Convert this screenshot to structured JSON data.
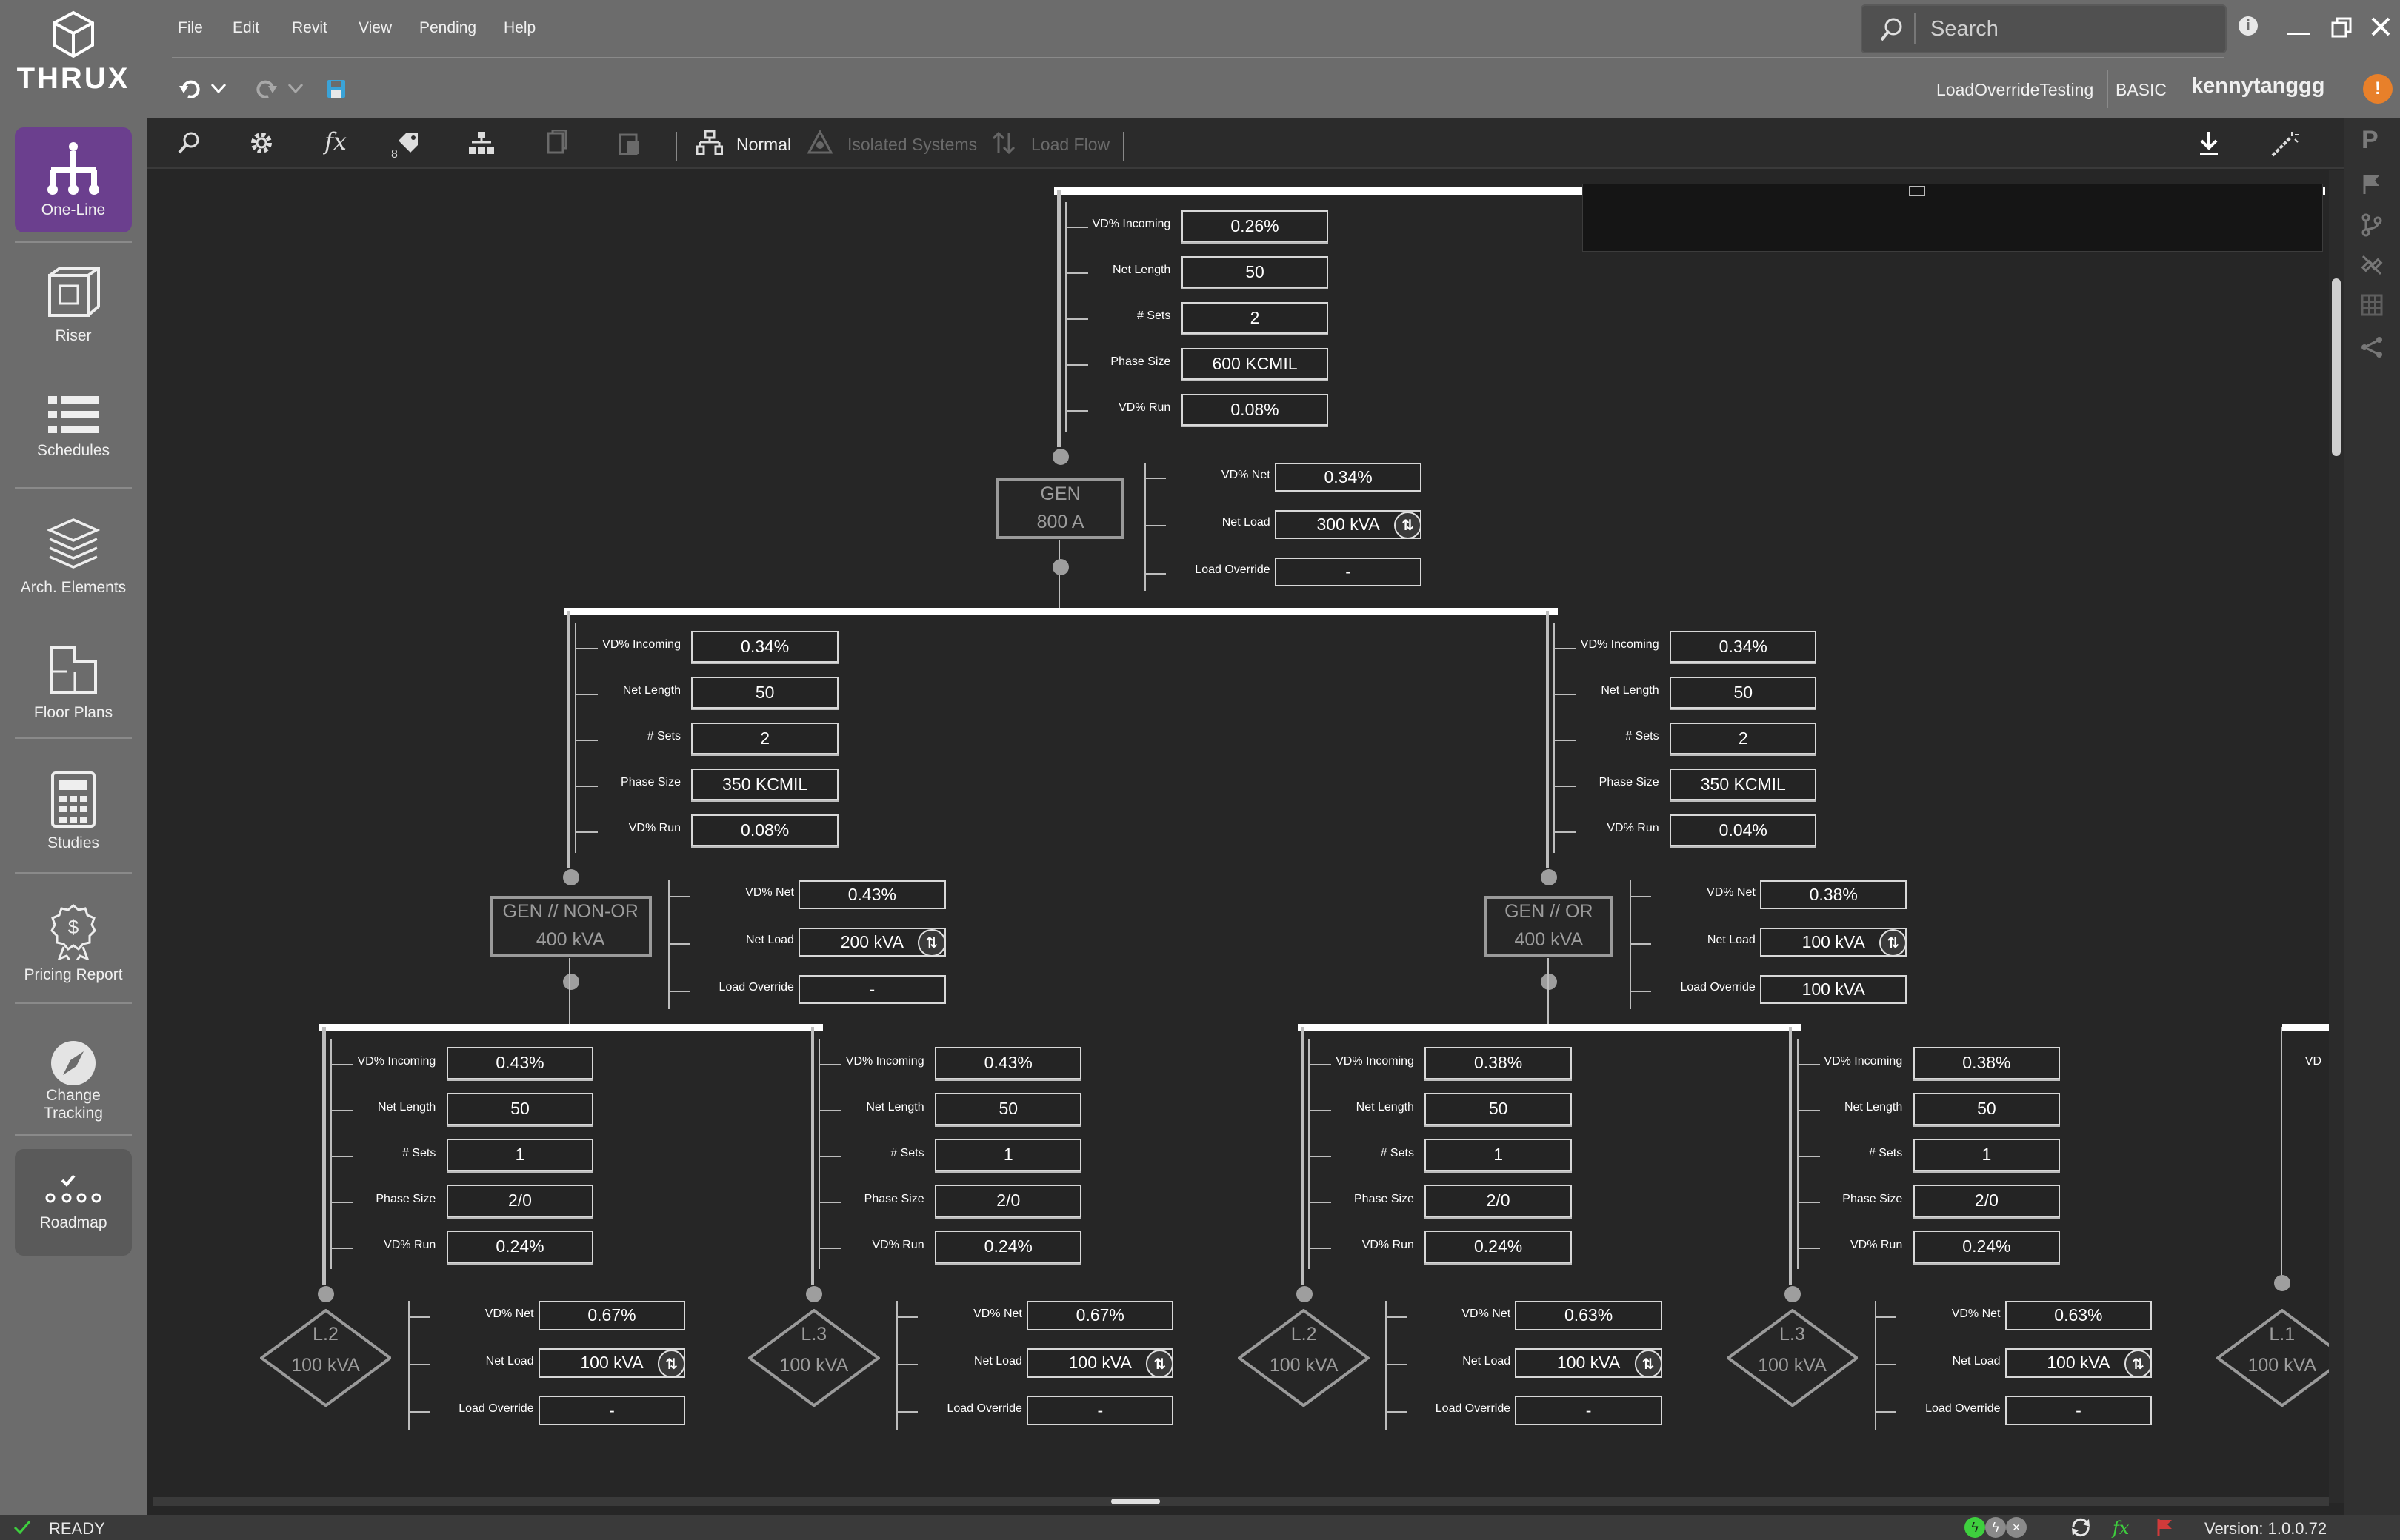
{
  "app": {
    "name": "THRUX"
  },
  "menu": [
    "File",
    "Edit",
    "Revit",
    "View",
    "Pending",
    "Help"
  ],
  "search": {
    "placeholder": "Search"
  },
  "project": {
    "name": "LoadOverrideTesting",
    "tier": "BASIC",
    "user": "kennytanggg",
    "badge": "!"
  },
  "sidebar": [
    {
      "label": "One-Line",
      "icon": "one-line-icon"
    },
    {
      "label": "Riser",
      "icon": "riser-cube-icon"
    },
    {
      "label": "Schedules",
      "icon": "schedules-list-icon"
    },
    {
      "label": "Arch. Elements",
      "icon": "layers-icon"
    },
    {
      "label": "Floor Plans",
      "icon": "floor-plan-icon"
    },
    {
      "label": "Studies",
      "icon": "calculator-icon"
    },
    {
      "label": "Pricing Report",
      "icon": "dollar-badge-icon"
    },
    {
      "label": "Change\nTracking",
      "icon": "compass-icon"
    },
    {
      "label": "Roadmap",
      "icon": "roadmap-icon"
    }
  ],
  "toolbar": {
    "tag_count": "8",
    "modes": [
      {
        "label": "Normal",
        "enabled": true
      },
      {
        "label": "Isolated Systems",
        "enabled": false
      },
      {
        "label": "Load Flow",
        "enabled": false
      }
    ]
  },
  "labels": {
    "vd_incoming": "VD% Incoming",
    "net_length": "Net Length",
    "sets": "# Sets",
    "phase_size": "Phase Size",
    "vd_run": "VD% Run",
    "vd_net": "VD% Net",
    "net_load": "Net Load",
    "load_override": "Load Override",
    "vd_partial": "VD"
  },
  "feeders": {
    "top": {
      "vd_incoming": "0.26%",
      "net_length": "50",
      "sets": "2",
      "phase_size": "600 KCMIL",
      "vd_run": "0.08%"
    },
    "left": {
      "vd_incoming": "0.34%",
      "net_length": "50",
      "sets": "2",
      "phase_size": "350 KCMIL",
      "vd_run": "0.08%"
    },
    "right": {
      "vd_incoming": "0.34%",
      "net_length": "50",
      "sets": "2",
      "phase_size": "350 KCMIL",
      "vd_run": "0.04%"
    },
    "ll": {
      "vd_incoming": "0.43%",
      "net_length": "50",
      "sets": "1",
      "phase_size": "2/0",
      "vd_run": "0.24%"
    },
    "lr": {
      "vd_incoming": "0.43%",
      "net_length": "50",
      "sets": "1",
      "phase_size": "2/0",
      "vd_run": "0.24%"
    },
    "rl": {
      "vd_incoming": "0.38%",
      "net_length": "50",
      "sets": "1",
      "phase_size": "2/0",
      "vd_run": "0.24%"
    },
    "rr": {
      "vd_incoming": "0.38%",
      "net_length": "50",
      "sets": "1",
      "phase_size": "2/0",
      "vd_run": "0.24%"
    }
  },
  "nodes": {
    "gen": {
      "name": "GEN",
      "rating": "800 A",
      "vd_net": "0.34%",
      "net_load": "300 kVA",
      "load_override": "-"
    },
    "nonor": {
      "name": "GEN // NON-OR",
      "rating": "400 kVA",
      "vd_net": "0.43%",
      "net_load": "200 kVA",
      "load_override": "-"
    },
    "or": {
      "name": "GEN // OR",
      "rating": "400 kVA",
      "vd_net": "0.38%",
      "net_load": "100 kVA",
      "load_override": "100 kVA"
    },
    "l2a": {
      "name": "L.2",
      "rating": "100 kVA",
      "vd_net": "0.67%",
      "net_load": "100 kVA",
      "load_override": "-"
    },
    "l3a": {
      "name": "L.3",
      "rating": "100 kVA",
      "vd_net": "0.67%",
      "net_load": "100 kVA",
      "load_override": "-"
    },
    "l2b": {
      "name": "L.2",
      "rating": "100 kVA",
      "vd_net": "0.63%",
      "net_load": "100 kVA",
      "load_override": "-"
    },
    "l3b": {
      "name": "L.3",
      "rating": "100 kVA",
      "vd_net": "0.63%",
      "net_load": "100 kVA",
      "load_override": "-"
    },
    "l1": {
      "name": "L.1",
      "rating": "100 kVA"
    }
  },
  "status": {
    "text": "READY",
    "version": "Version: 1.0.0.72"
  },
  "right_panel": {
    "letter": "P"
  },
  "colors": {
    "accent": "#6b3f8e",
    "bus": "#ffffff",
    "status_green": "#3ecf3e",
    "badge_orange": "#e8802a"
  }
}
